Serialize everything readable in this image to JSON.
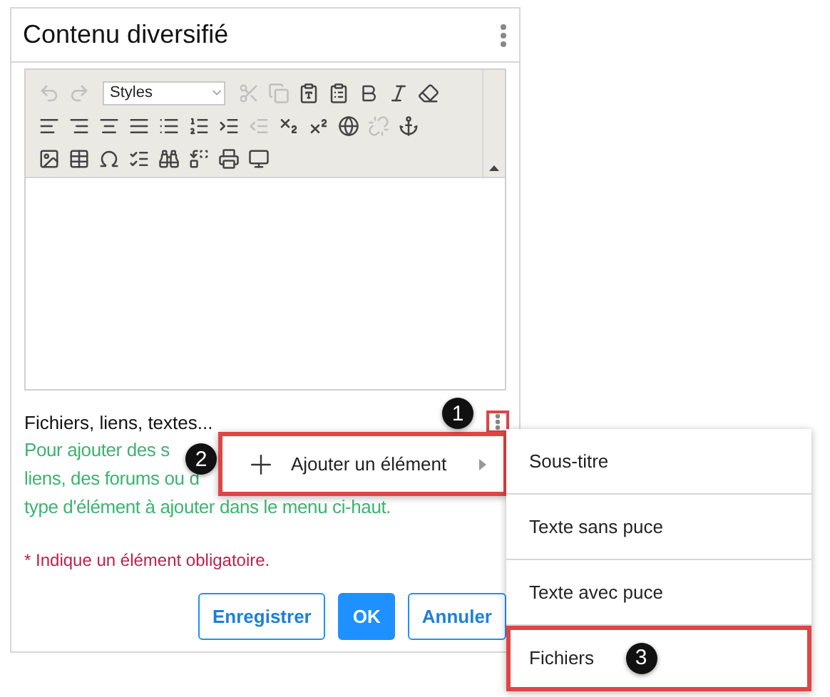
{
  "card": {
    "title": "Contenu diversifié"
  },
  "editor": {
    "styles_placeholder": "Styles",
    "toolbar": [
      [
        {
          "disabled": true
        },
        {
          "disabled": true
        },
        {
          "kind": "styles"
        },
        {
          "disabled": true
        },
        {
          "disabled": true
        },
        {
          "disabled": false
        },
        {
          "disabled": false
        },
        {
          "disabled": false
        },
        {
          "disabled": false
        },
        {
          "disabled": false
        }
      ],
      [
        {
          "disabled": false
        },
        {
          "disabled": false
        },
        {
          "disabled": false
        },
        {
          "disabled": false
        },
        {
          "disabled": false
        },
        {
          "disabled": false
        },
        {
          "disabled": false
        },
        {
          "disabled": true
        },
        {
          "disabled": false
        },
        {
          "disabled": false
        },
        {
          "disabled": false
        },
        {
          "disabled": true
        },
        {
          "disabled": false
        }
      ],
      [
        {
          "disabled": false
        },
        {
          "disabled": false
        },
        {
          "disabled": false
        },
        {
          "disabled": false
        },
        {
          "disabled": false
        },
        {
          "disabled": false
        },
        {
          "disabled": false
        },
        {
          "disabled": false
        }
      ]
    ]
  },
  "section": {
    "label": "Fichiers, liens, textes...",
    "outlined": true,
    "help_lines": [
      "Pour ajouter des s",
      "liens, des forums ou d",
      "type d'élément à ajouter dans le menu ci-haut."
    ]
  },
  "required_note": {
    "mark": "*",
    "text": "Indique un élément obligatoire."
  },
  "buttons": [
    {
      "label": "Enregistrer",
      "kind": "outline"
    },
    {
      "label": "OK",
      "kind": "primary"
    },
    {
      "label": "Annuler",
      "kind": "outline"
    }
  ],
  "menu": {
    "items": [
      {
        "label": "Ajouter un élément",
        "outlined": true
      }
    ]
  },
  "submenu": {
    "items": [
      {
        "label": "Sous-titre",
        "outlined": false
      },
      {
        "label": "Texte sans puce",
        "outlined": false
      },
      {
        "label": "Texte avec puce",
        "outlined": false
      },
      {
        "label": "Fichiers",
        "outlined": true
      }
    ]
  },
  "callouts": [
    "1",
    "2",
    "3"
  ]
}
